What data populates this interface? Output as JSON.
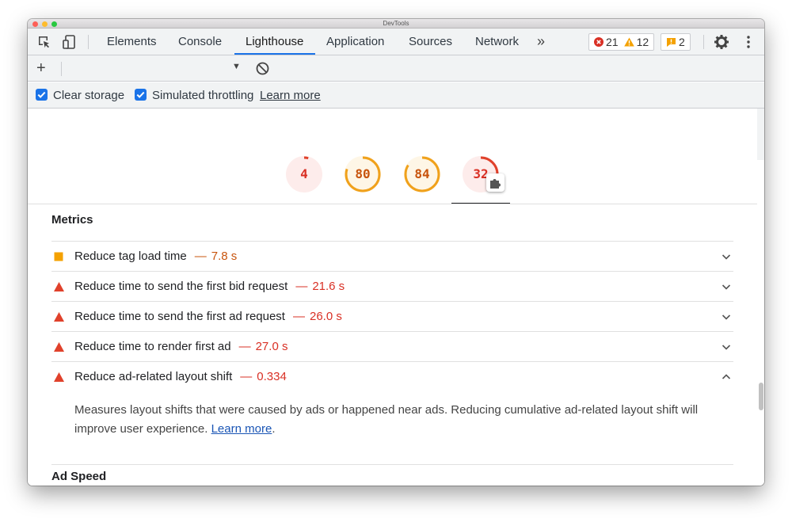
{
  "window": {
    "title": "DevTools"
  },
  "toolbar": {
    "tabs": [
      "Elements",
      "Console",
      "Lighthouse",
      "Application",
      "Sources",
      "Network"
    ],
    "active_tab": "Lighthouse",
    "more_tabs_label": "»",
    "errors_count": "21",
    "warnings_count": "12",
    "issues_count": "2"
  },
  "subtoolbar": {
    "add_label": "+",
    "dropdown_arrow": "▼"
  },
  "options": {
    "clear_storage_label": "Clear storage",
    "clear_storage_checked": true,
    "throttling_label": "Simulated throttling",
    "throttling_checked": true,
    "learn_more_label": "Learn more"
  },
  "gauges": [
    {
      "score": "4",
      "fraction": 0.04,
      "color": "#e0412b",
      "bg": "#fdeceb"
    },
    {
      "score": "80",
      "fraction": 0.8,
      "color": "#f0a11b",
      "bg": "#fef6e6"
    },
    {
      "score": "84",
      "fraction": 0.84,
      "color": "#f0a11b",
      "bg": "#fef6e6"
    },
    {
      "score": "32",
      "fraction": 0.32,
      "color": "#e0412b",
      "bg": "#fdeceb"
    }
  ],
  "metrics": {
    "title": "Metrics",
    "audits": [
      {
        "title": "Reduce tag load time",
        "sep": "—",
        "value": "7.8 s",
        "status": "average",
        "expanded": false
      },
      {
        "title": "Reduce time to send the first bid request",
        "sep": "—",
        "value": "21.6 s",
        "status": "fail",
        "expanded": false
      },
      {
        "title": "Reduce time to send the first ad request",
        "sep": "—",
        "value": "26.0 s",
        "status": "fail",
        "expanded": false
      },
      {
        "title": "Reduce time to render first ad",
        "sep": "—",
        "value": "27.0 s",
        "status": "fail",
        "expanded": false
      },
      {
        "title": "Reduce ad-related layout shift",
        "sep": "—",
        "value": "0.334",
        "status": "fail",
        "expanded": true
      }
    ],
    "expanded_description": "Measures layout shifts that were caused by ads or happened near ads. Reducing cumulative ad-related layout shift will improve user experience.",
    "expanded_line1": "Measures layout shifts that were caused by ads or happened near ads. Reducing cumulative ad-related layout shift will",
    "expanded_line2": "improve user experience.",
    "expanded_link": "Learn more",
    "expanded_trailing": "."
  },
  "next_section": {
    "title": "Ad Speed"
  },
  "colors": {
    "fail": "#d93025",
    "average": "#c8540d",
    "average_icon": "#f4a100",
    "accent": "#1a73e8"
  }
}
